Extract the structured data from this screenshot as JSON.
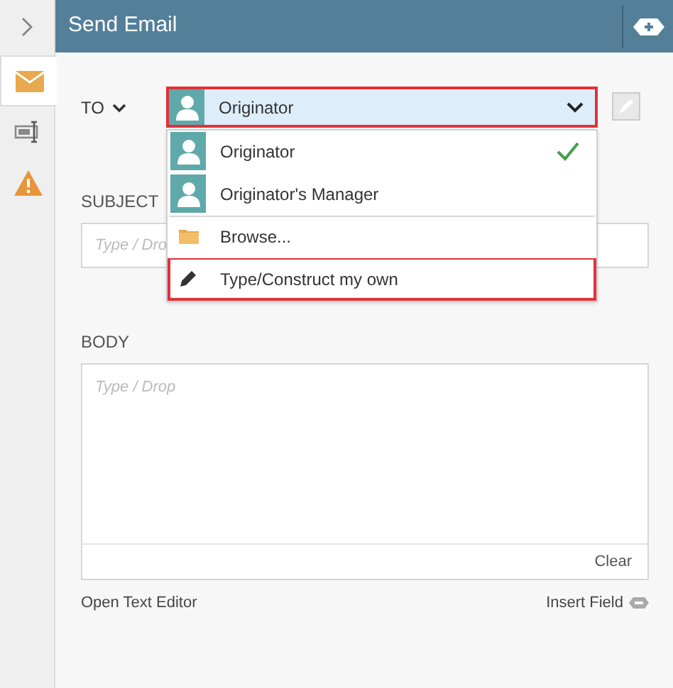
{
  "header": {
    "title": "Send Email"
  },
  "rail": {
    "tabs": [
      {
        "kind": "email",
        "selected": true
      },
      {
        "kind": "form",
        "selected": false
      },
      {
        "kind": "warning",
        "selected": false
      }
    ]
  },
  "to": {
    "label": "TO",
    "value": "Originator",
    "highlighted": true
  },
  "to_menu": [
    {
      "kind": "person",
      "label": "Originator",
      "selected": true,
      "highlighted": false
    },
    {
      "kind": "person",
      "label": "Originator's Manager",
      "selected": false,
      "highlighted": false
    },
    {
      "kind": "folder",
      "label": "Browse...",
      "selected": false,
      "highlighted": false
    },
    {
      "kind": "pencil",
      "label": "Type/Construct my own",
      "selected": false,
      "highlighted": true
    }
  ],
  "subject": {
    "label": "SUBJECT",
    "placeholder": "Type / Dro"
  },
  "body": {
    "label": "BODY",
    "placeholder": "Type / Drop",
    "clear": "Clear"
  },
  "footer": {
    "open_editor": "Open Text Editor",
    "insert_field": "Insert Field"
  }
}
